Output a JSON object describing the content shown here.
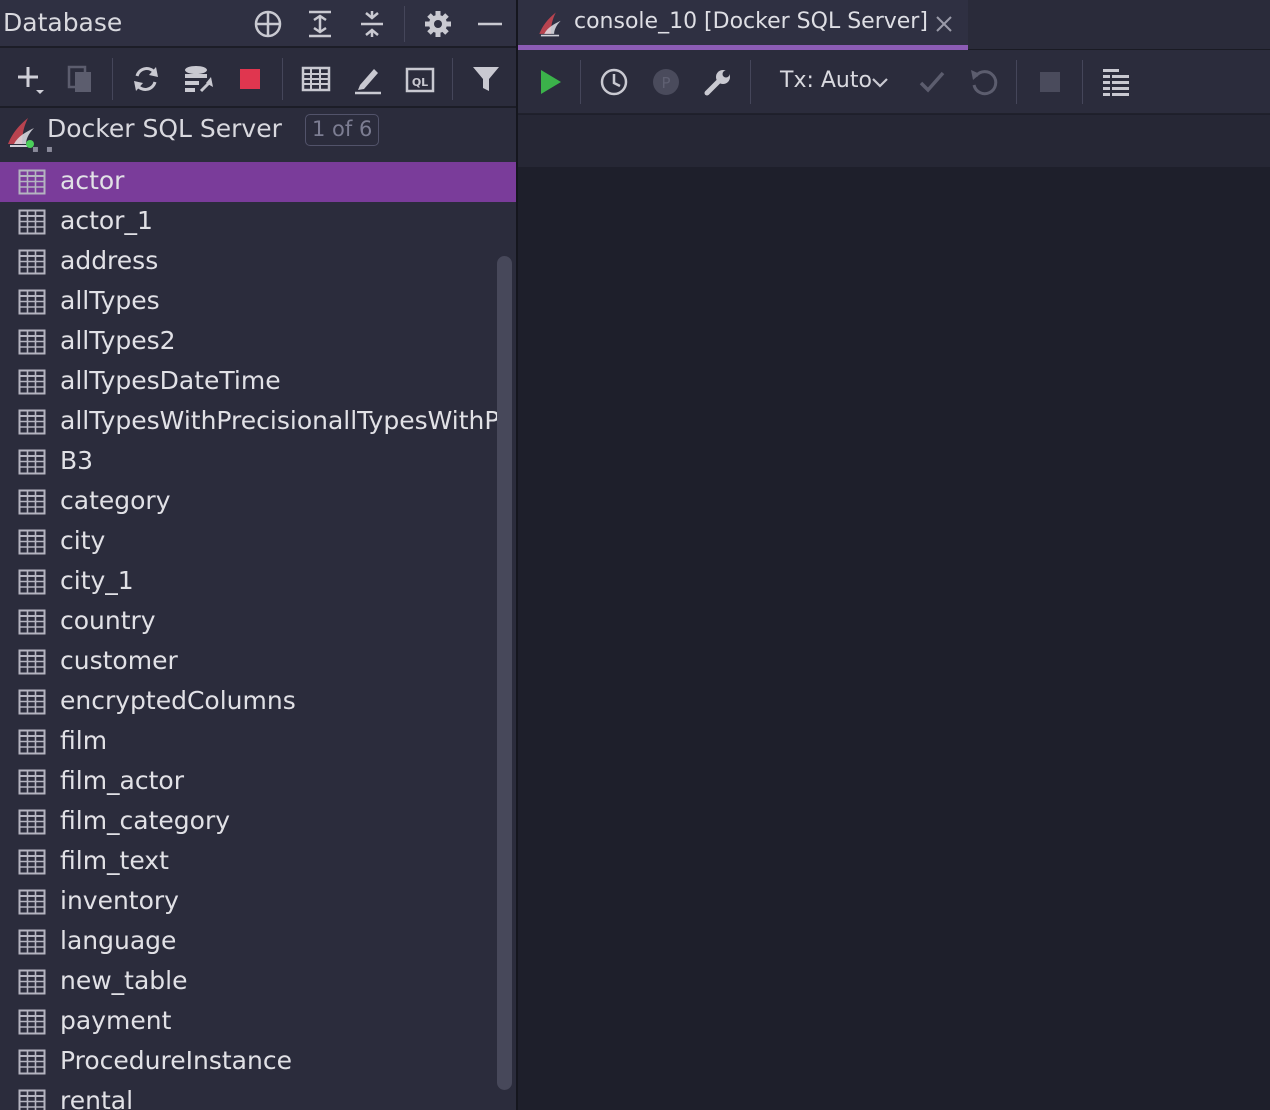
{
  "panel": {
    "title": "Database"
  },
  "header_icons": [
    "crosshair-icon",
    "expand-all-icon",
    "collapse-all-icon",
    "gear-icon",
    "minimize-icon"
  ],
  "toolbar_icons": [
    "add-icon",
    "copy-icon",
    "refresh-icon",
    "schema-sync-icon",
    "stop-icon",
    "table-icon",
    "edit-icon",
    "ql-console-icon",
    "filter-icon"
  ],
  "connection": {
    "name": "Docker SQL Server",
    "count": "1 of 6"
  },
  "tree": {
    "items": [
      {
        "label": "actor",
        "selected": true
      },
      {
        "label": "actor_1"
      },
      {
        "label": "address"
      },
      {
        "label": "allTypes"
      },
      {
        "label": "allTypes2"
      },
      {
        "label": "allTypesDateTime"
      },
      {
        "label": "allTypesWithPrecisionallTypesWithPr"
      },
      {
        "label": "B3"
      },
      {
        "label": "category"
      },
      {
        "label": "city"
      },
      {
        "label": "city_1"
      },
      {
        "label": "country"
      },
      {
        "label": "customer"
      },
      {
        "label": "encryptedColumns"
      },
      {
        "label": "film"
      },
      {
        "label": "film_actor"
      },
      {
        "label": "film_category"
      },
      {
        "label": "film_text"
      },
      {
        "label": "inventory"
      },
      {
        "label": "language"
      },
      {
        "label": "new_table"
      },
      {
        "label": "payment"
      },
      {
        "label": "ProcedureInstance"
      },
      {
        "label": "rental"
      }
    ]
  },
  "editor_tab": {
    "label": "console_10 [Docker SQL Server]"
  },
  "console_toolbar": {
    "tx_label": "Tx: Auto",
    "icons": [
      "run-icon",
      "history-icon",
      "parameter-icon",
      "settings-wrench-icon",
      "commit-icon",
      "rollback-icon",
      "stop-icon",
      "output-layout-icon"
    ]
  },
  "colors": {
    "accent": "#7a3c9a",
    "run": "#3bb24a",
    "stop": "#e0364f"
  }
}
